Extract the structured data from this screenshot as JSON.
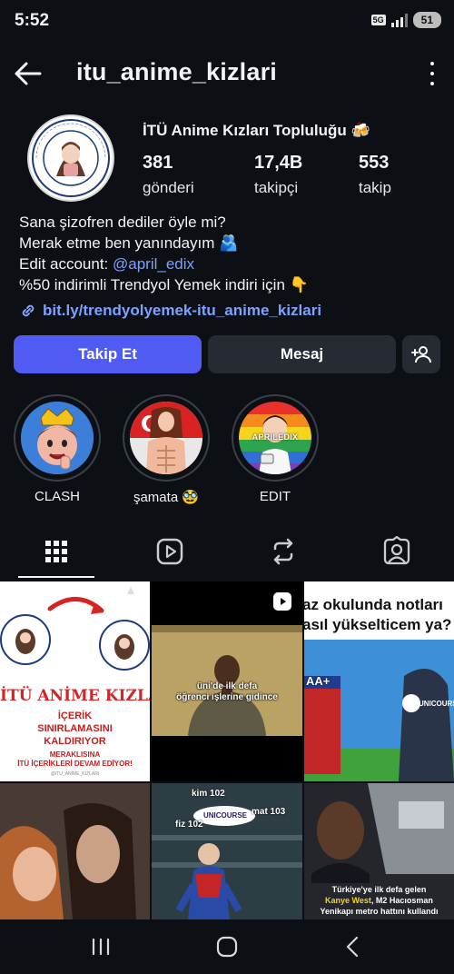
{
  "status": {
    "time": "5:52",
    "network": "5G",
    "battery": "51"
  },
  "header": {
    "username": "itu_anime_kizlari",
    "back_icon": "arrow-left-icon",
    "menu_icon": "more-vertical-icon"
  },
  "profile": {
    "display_name": "İTÜ Anime Kızları Topluluğu 🍻",
    "stats": [
      {
        "value": "381",
        "label": "gönderi"
      },
      {
        "value": "17,4B",
        "label": "takipçi"
      },
      {
        "value": "553",
        "label": "takip"
      }
    ],
    "bio": {
      "line1": "Sana şizofren dediler öyle mi?",
      "line2": "Merak etme ben yanındayım 🫂",
      "line3_prefix": "Edit account: ",
      "line3_mention": "@april_edix",
      "line4": "%50 indirimli Trendyol Yemek indiri için 👇"
    },
    "link": "bit.ly/trendyolyemek-itu_anime_kizlari"
  },
  "actions": {
    "follow": "Takip Et",
    "message": "Mesaj"
  },
  "highlights": [
    {
      "name": "CLASH"
    },
    {
      "name": "şamata 🥸"
    },
    {
      "name": "EDIT",
      "overlay": "APRILEDIX"
    }
  ],
  "tabs": [
    "grid-icon",
    "reels-icon",
    "reposts-icon",
    "tagged-icon"
  ],
  "posts": {
    "p1": {
      "title": "İTÜ ANİME KIZLAR",
      "line1": "İÇERİK",
      "line2": "SINIRLAMASINI",
      "line3": "KALDIRIYOR",
      "sub1": "MERAKLISINA",
      "sub2": "İTÜ İÇERİKLERİ DEVAM EDİYOR!",
      "handle": "@ITU_ANIME_KIZLARI"
    },
    "p2": {
      "caption1": "üni'de ilk defa",
      "caption2": "öğrenci işlerine gidince"
    },
    "p3": {
      "line1": "az okulunda notları",
      "line2": "asıl yükselticem ya?",
      "grade": "AA+",
      "brand": "UNICOURS"
    },
    "p5": {
      "l1": "kim 102",
      "l2": "fiz 102",
      "l3": "mat 103",
      "brand": "UNICOURSE"
    },
    "p6": {
      "c1": "Türkiye'ye ilk defa gelen",
      "c2a": "Kanye West",
      "c2b": ", M2 Hacıosman",
      "c3": "Yenikapı metro hattını kullandı"
    }
  },
  "colors": {
    "accent": "#4f5bf2",
    "link": "#7ea1ff",
    "background": "#0c0f14",
    "button": "#252a33"
  }
}
